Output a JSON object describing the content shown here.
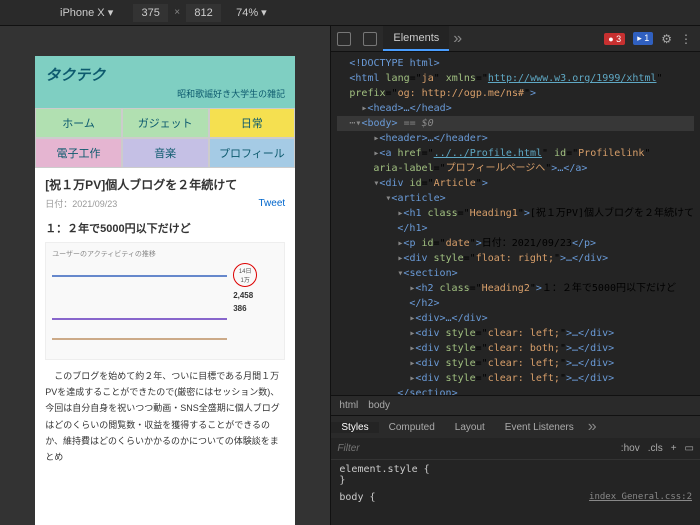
{
  "topbar": {
    "device": "iPhone X ▾",
    "width": "375",
    "height": "812",
    "zoom": "74% ▾"
  },
  "site": {
    "title": "タクテク",
    "subtitle": "昭和歌謡好き大学生の雑記",
    "nav_row1": [
      "ホーム",
      "ガジェット",
      "日常"
    ],
    "nav_row2": [
      "電子工作",
      "音楽",
      "プロフィール"
    ]
  },
  "article": {
    "title": "[祝１万PV]個人ブログを２年続けて",
    "date": "日付：2021/09/23",
    "tweet": "Tweet",
    "h2": "１：２年で5000円以下だけど",
    "body": "　このブログを始めて約２年、ついに目標である月間１万PVを達成することができたので(厳密にはセッション数)、今回は自分自身を祝いつつ動画・SNS全盛期に個人ブログはどのくらいの閲覧数・収益を獲得することができるのか、維持費はどのくらいかかるのかについての体験談をまとめ"
  },
  "chart_data": {
    "type": "line",
    "title": "ユーザーのアクティビティの推移",
    "highlight_label": "14日",
    "highlight_value": "1万",
    "stats": [
      {
        "dot_color": "#6688cc",
        "value": "2,458"
      },
      {
        "dot_color": "#8866cc",
        "value": "386"
      }
    ]
  },
  "devtools": {
    "tabs": {
      "elements": "Elements"
    },
    "badges": {
      "errors": "3",
      "info": "1"
    },
    "dom": {
      "doctype": "<!DOCTYPE html>",
      "html_lang": "ja",
      "html_xmlns": "http://www.w3.org/1999/xhtml",
      "html_prefix": "og: http://ogp.me/ns#",
      "head": "<head>…</head>",
      "body_comment": " == $0",
      "header": "<header>…</header>",
      "a_href": "../../Profile.html",
      "a_id": "Profilelink",
      "a_aria": "プロフィールページへ",
      "div_id": "Article",
      "h1_class": "Heading1",
      "h1_text": "[祝１万PV]個人ブログを２年続けて",
      "subh1": "</h1>",
      "p_id": "date",
      "p_text": "日付：2021/09/23",
      "float_right": "float: right;",
      "h2_class": "Heading2",
      "h2_text": "１：２年で5000円以下だけど",
      "clear_left": "clear: left;",
      "clear_both": "clear: both;"
    },
    "breadcrumb": [
      "html",
      "body"
    ],
    "styles_tabs": [
      "Styles",
      "Computed",
      "Layout",
      "Event Listeners"
    ],
    "filter_placeholder": "Filter",
    "filter_btns": [
      ":hov",
      ".cls",
      "+"
    ],
    "element_style": "element.style {",
    "body_rule": "body {",
    "css_file": "index_General.css:2"
  }
}
